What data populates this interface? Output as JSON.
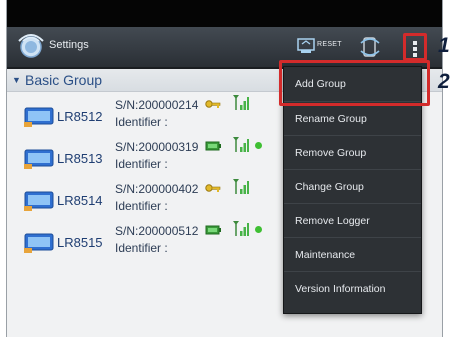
{
  "app": {
    "title": "Settings"
  },
  "toolbar": {
    "reset_label": "RESET"
  },
  "group": {
    "name": "Basic Group"
  },
  "loggers": [
    {
      "name": "LR8512",
      "serial": "S/N:200000214",
      "identifier": "Identifier :",
      "indicator": "key-icon",
      "online": false
    },
    {
      "name": "LR8513",
      "serial": "S/N:200000319",
      "identifier": "Identifier :",
      "indicator": "battery-icon",
      "online": true
    },
    {
      "name": "LR8514",
      "serial": "S/N:200000402",
      "identifier": "Identifier :",
      "indicator": "key-icon",
      "online": false
    },
    {
      "name": "LR8515",
      "serial": "S/N:200000512",
      "identifier": "Identifier :",
      "indicator": "battery-icon",
      "online": true
    }
  ],
  "menu": {
    "items": [
      "Add Group",
      "Rename Group",
      "Remove Group",
      "Change Group",
      "Remove Logger",
      "Maintenance",
      "Version Information"
    ]
  },
  "callouts": {
    "one": "1",
    "two": "2"
  },
  "colors": {
    "highlight": "#d32b2b",
    "online": "#3fbf33",
    "group_text": "#2a4f86"
  }
}
